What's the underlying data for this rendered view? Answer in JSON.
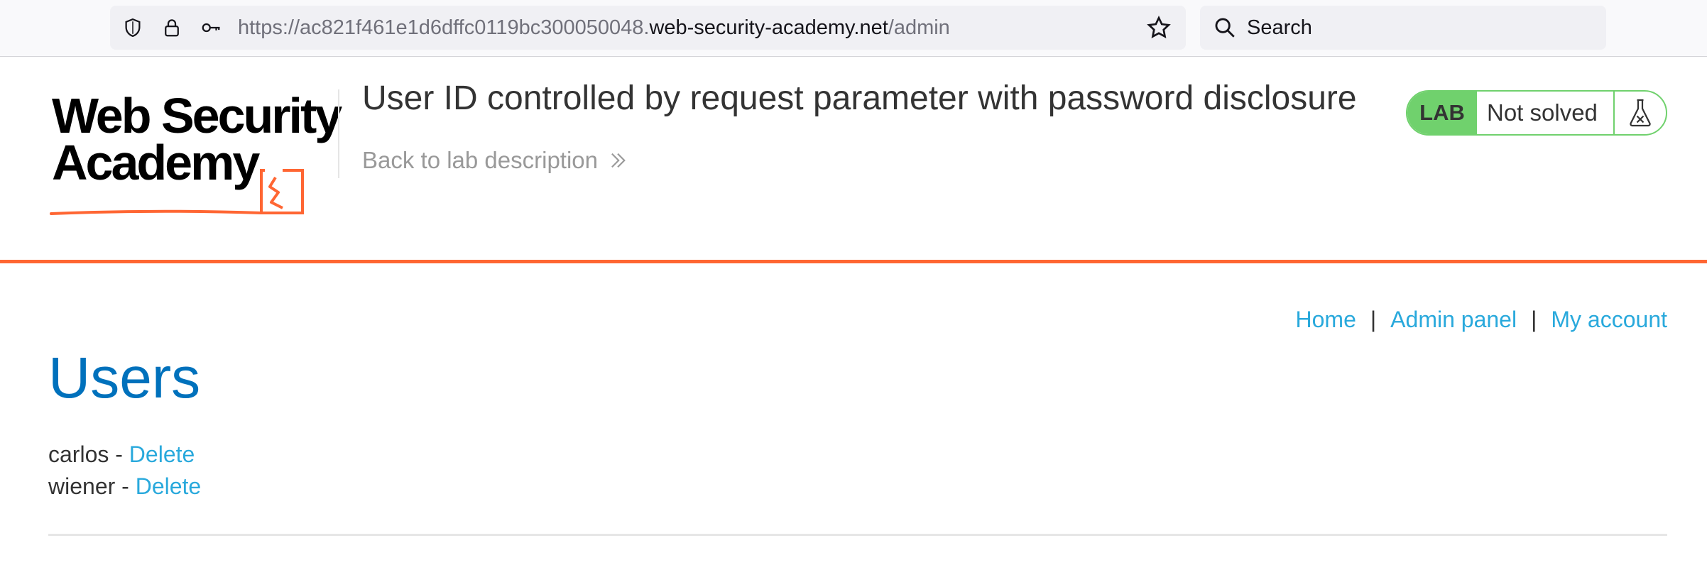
{
  "browser": {
    "url_prefix": "https://ac821f461e1d6dffc0119bc300050048.",
    "url_domain": "web-security-academy.net",
    "url_path": "/admin",
    "search_placeholder": "Search"
  },
  "header": {
    "logo_line1": "Web Security",
    "logo_line2": "Academy",
    "lab_title": "User ID controlled by request parameter with password disclosure",
    "back_link": "Back to lab description",
    "lab_badge": "LAB",
    "lab_state": "Not solved"
  },
  "nav": {
    "home": "Home",
    "separator": "|",
    "admin_panel": "Admin panel",
    "my_account": "My account"
  },
  "main": {
    "heading": "Users",
    "users": [
      {
        "name": "carlos",
        "dash": " - ",
        "action": "Delete"
      },
      {
        "name": "wiener",
        "dash": " - ",
        "action": "Delete"
      }
    ]
  },
  "colors": {
    "accent_orange": "#ff6633",
    "link_blue": "#29a9dc",
    "heading_blue": "#0071bc",
    "lab_green": "#70d16d"
  }
}
